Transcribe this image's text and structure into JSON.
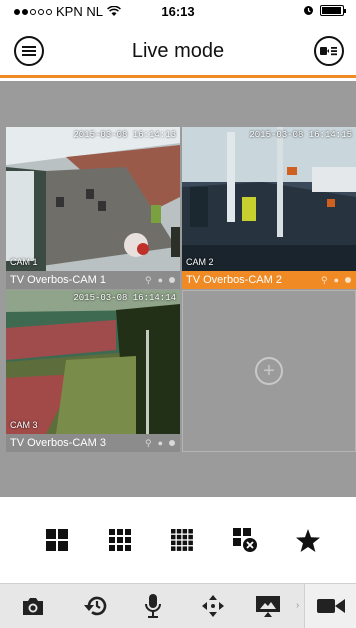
{
  "status_bar": {
    "carrier": "KPN NL",
    "time": "16:13"
  },
  "header": {
    "title": "Live mode",
    "menu_icon": "hamburger-menu-icon",
    "right_icon": "device-list-icon"
  },
  "cameras": [
    {
      "name": "TV Overbos-CAM 1",
      "overlay_label": "CAM 1",
      "timestamp": "2015-03-08 16:14:13",
      "active": false
    },
    {
      "name": "TV Overbos-CAM 2",
      "overlay_label": "CAM 2",
      "timestamp": "2015-03-08 16:14:15",
      "active": true
    },
    {
      "name": "TV Overbos-CAM 3",
      "overlay_label": "CAM 3",
      "timestamp": "2015-03-08 16:14:14",
      "active": false
    }
  ],
  "empty_slot_icon": "add-channel-icon",
  "layout_buttons": [
    "grid-2x2-icon",
    "grid-3x3-icon",
    "grid-4x4-icon",
    "close-all-icon",
    "favorite-star-icon"
  ],
  "toolbar_buttons": [
    "snapshot-camera-icon",
    "playback-icon",
    "microphone-icon",
    "ptz-arrows-icon",
    "cast-screen-icon",
    "record-video-icon"
  ],
  "colors": {
    "accent": "#f08a24",
    "background_grid": "#9b9b9b",
    "toolbar_bg": "#e7e7e7"
  }
}
